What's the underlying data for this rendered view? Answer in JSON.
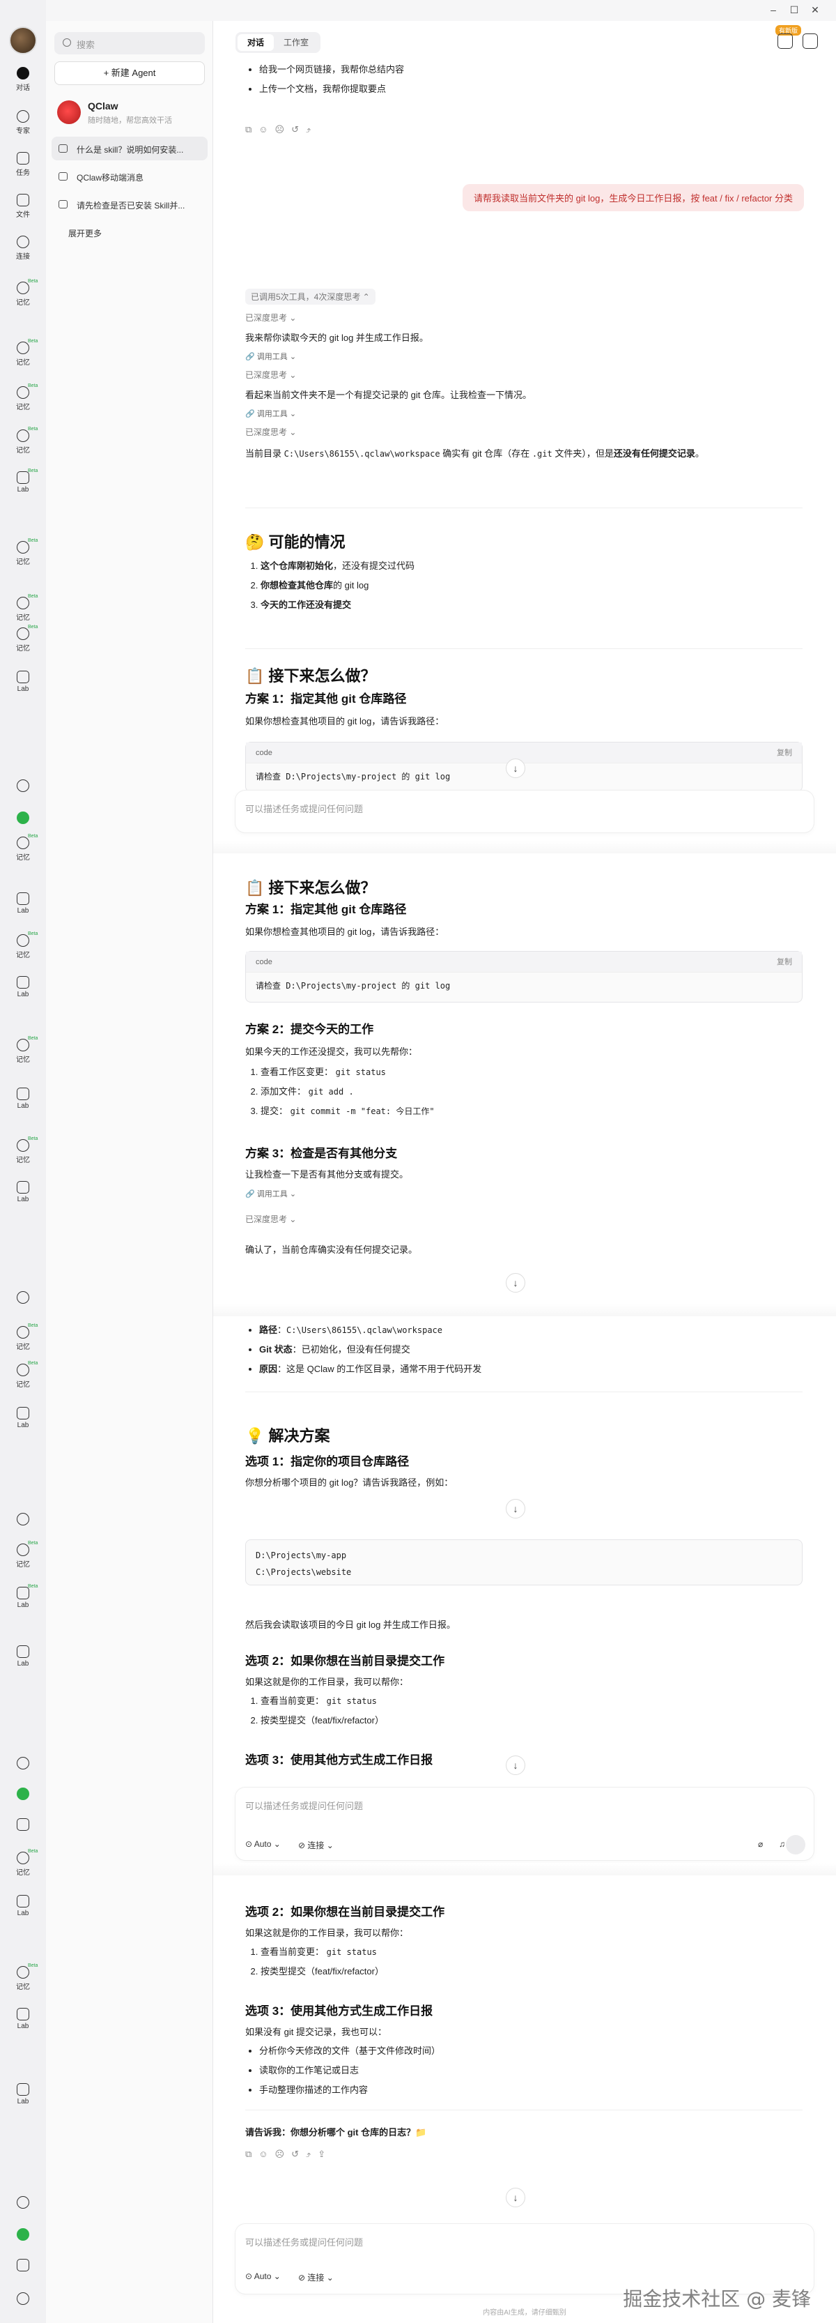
{
  "window": {
    "update_badge": "有新版"
  },
  "rail": {
    "items": [
      {
        "label": "对话"
      },
      {
        "label": "专家"
      },
      {
        "label": "任务"
      },
      {
        "label": "文件"
      },
      {
        "label": "连接"
      },
      {
        "label": "记忆"
      },
      {
        "label": "记忆"
      },
      {
        "label": "记忆"
      },
      {
        "label": "记忆"
      },
      {
        "label": "记忆"
      },
      {
        "label": "记忆"
      },
      {
        "label": "记忆"
      },
      {
        "label": "记忆"
      },
      {
        "label": "记忆"
      },
      {
        "label": "Lab"
      }
    ],
    "beta": "Beta",
    "lab": "Lab",
    "memory": "记忆"
  },
  "sidebar": {
    "search_placeholder": "搜索",
    "new_agent": "+ 新建 Agent",
    "agent": {
      "name": "QClaw",
      "desc": "随时随地，帮您高效干活"
    },
    "history": [
      {
        "title": "什么是 skill？说明如何安装..."
      },
      {
        "title": "QClaw移动端消息"
      },
      {
        "title": "请先检查是否已安装 Skill并..."
      },
      {
        "title": "展开更多"
      }
    ]
  },
  "main": {
    "tabs": [
      "对话",
      "工作室"
    ],
    "intro_bullets": [
      "给我一个网页链接，我帮你总结内容",
      "上传一个文档，我帮你提取要点"
    ],
    "user_message": "请帮我读取当前文件夹的 git log，生成今日工作日报，按 feat / fix / refactor 分类",
    "tool_summary": "已调用5次工具，4次深度思考 ⌃",
    "deep_think": "已深度思考 ⌄",
    "call_tool": "调用工具 ⌄",
    "step1": "我来帮你读取今天的 git log 并生成工作日报。",
    "step2": "看起来当前文件夹不是一个有提交记录的 git 仓库。让我检查一下情况。",
    "current_dir_prefix": "当前目录",
    "current_dir_path": "C:\\Users\\86155\\.qclaw\\workspace",
    "current_dir_mid": "确实有 git 仓库（存在",
    "git_dir": ".git",
    "current_dir_mid2": "文件夹），但是",
    "current_dir_bold": "还没有任何提交记录",
    "current_dir_end": "。",
    "possible_title": "🤔 可能的情况",
    "possible": [
      {
        "bold": "这个仓库刚初始化",
        "rest": "，还没有提交过代码"
      },
      {
        "bold": "你想检查其他仓库",
        "rest": "的 git log"
      },
      {
        "bold": "今天的工作还没有提交",
        "rest": ""
      }
    ],
    "next_title": "📋 接下来怎么做？",
    "plan1_title": "方案 1：指定其他 git 仓库路径",
    "plan1_desc": "如果你想检查其他项目的 git log，请告诉我路径：",
    "code_label": "code",
    "copy": "复制",
    "code1": "请检查 D:\\Projects\\my-project 的 git log",
    "input_placeholder": "可以描述任务或提问任何问题",
    "plan2_title": "方案 2：提交今天的工作",
    "plan2_desc": "如果今天的工作还没提交，我可以先帮你：",
    "plan2_steps": [
      {
        "text": "查看工作区变更：",
        "code": "git status"
      },
      {
        "text": "添加文件：",
        "code": "git add ."
      },
      {
        "text": "提交：",
        "code": "git commit -m \"feat: 今日工作\""
      }
    ],
    "plan3_title": "方案 3：检查是否有其他分支",
    "plan3_desc": "让我检查一下是否有其他分支或有提交。",
    "confirm": "确认了，当前仓库确实没有任何提交记录。",
    "info": [
      {
        "label": "路径",
        "sep": "：",
        "value": "C:\\Users\\86155\\.qclaw\\workspace",
        "mono": true
      },
      {
        "label": "Git 状态",
        "sep": "：",
        "value": "已初始化，但没有任何提交",
        "mono": false
      },
      {
        "label": "原因",
        "sep": "：",
        "value": "这是 QClaw 的工作区目录，通常不用于代码开发",
        "mono": false
      }
    ],
    "solution_title": "💡 解决方案",
    "opt1_title": "选项 1：指定你的项目仓库路径",
    "opt1_desc": "你想分析哪个项目的 git log？请告诉我路径，例如：",
    "opt1_code": [
      "D:\\Projects\\my-app",
      "C:\\Projects\\website"
    ],
    "opt1_after": "然后我会读取该项目的今日 git log 并生成工作日报。",
    "opt2_title": "选项 2：如果你想在当前目录提交工作",
    "opt2_desc": "如果这就是你的工作目录，我可以帮你：",
    "opt2_steps": [
      {
        "text": "查看当前变更：",
        "code": "git status"
      },
      {
        "text": "按类型提交（feat/fix/refactor）",
        "code": ""
      }
    ],
    "opt3_title": "选项 3：使用其他方式生成工作日报",
    "opt3_desc": "如果没有 git 提交记录，我也可以：",
    "opt3_items": [
      "分析你今天修改的文件（基于文件修改时间）",
      "读取你的工作笔记或日志",
      "手动整理你描述的工作内容"
    ],
    "ask": "请告诉我：你想分析哪个 git 仓库的日志？📁",
    "auto": "⊙ Auto ⌄",
    "connect": "⊘ 连接 ⌄",
    "footer": "内容由AI生成，请仔细甄别",
    "watermark": "掘金技术社区 @ 麦锋"
  }
}
